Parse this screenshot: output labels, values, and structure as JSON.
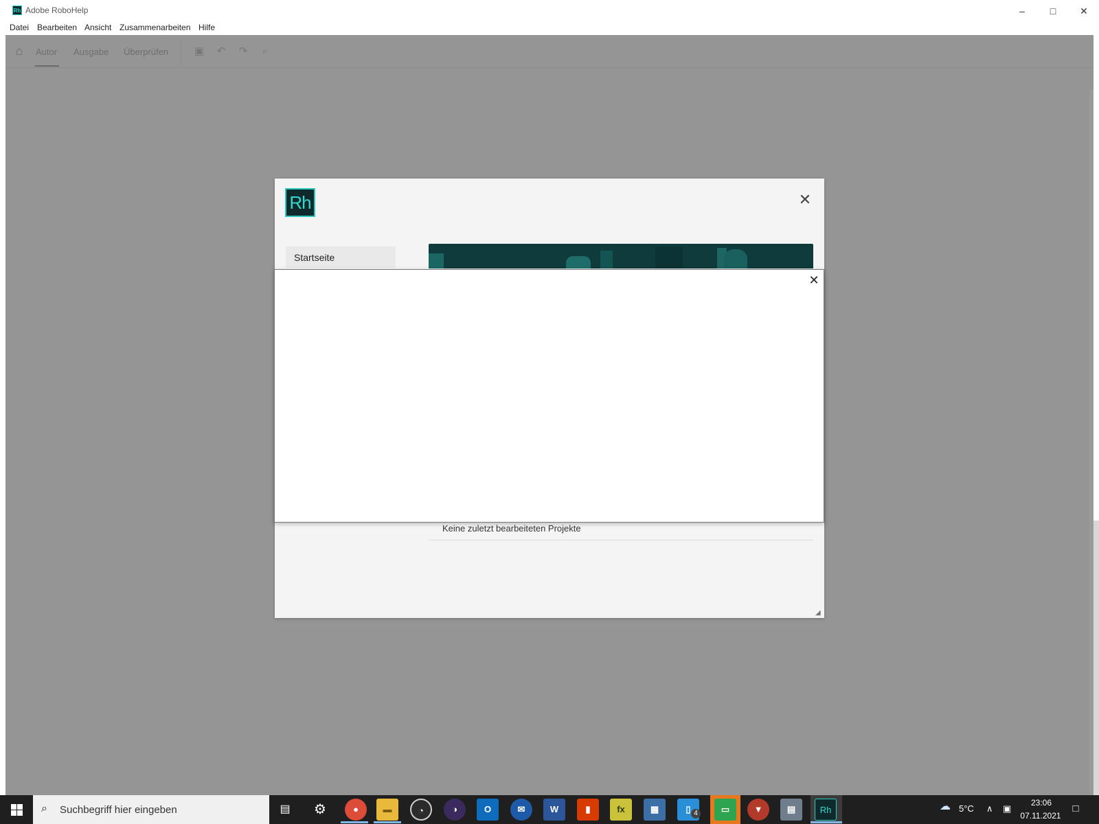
{
  "window": {
    "title": "Adobe RoboHelp",
    "app_icon_text": "Rh"
  },
  "menu": [
    "Datei",
    "Bearbeiten",
    "Ansicht",
    "Zusammenarbeiten",
    "Hilfe"
  ],
  "toolbar": {
    "tabs": [
      "Autor",
      "Ausgabe",
      "Überprüfen"
    ],
    "active_tab": "Autor"
  },
  "welcome": {
    "logo_text": "Rh",
    "nav_item": "Startseite",
    "recent_empty": "Keine zuletzt bearbeiteten Projekte"
  },
  "taskbar": {
    "search_placeholder": "Suchbegriff hier eingeben",
    "badge_count": "4",
    "active_app_text": "Rh",
    "weather_temp": "5°C",
    "time": "23:06",
    "date": "07.11.2021"
  },
  "colors": {
    "accent": "#2cc9bd",
    "overlay": "#959595",
    "taskbar": "#1f1f1f"
  }
}
